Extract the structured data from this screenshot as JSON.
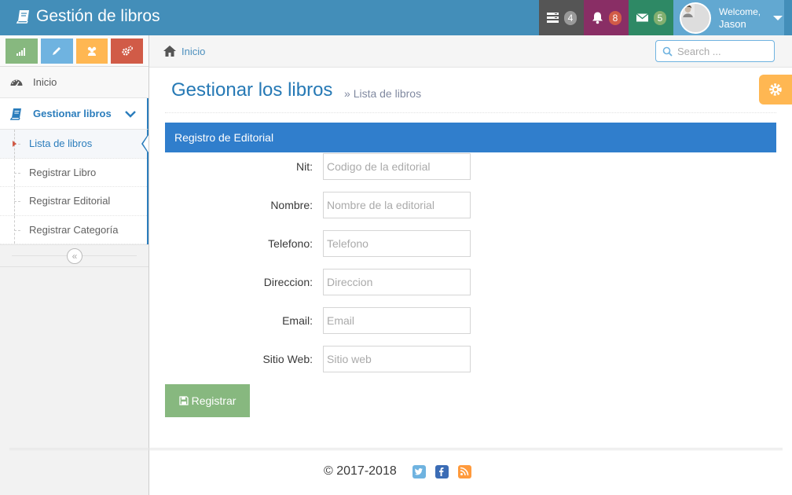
{
  "navbar": {
    "brand": "Gestión de libros",
    "tasks_count": "4",
    "notifications_count": "8",
    "messages_count": "5",
    "welcome": "Welcome,",
    "user_name": "Jason"
  },
  "sidebar": {
    "items": [
      {
        "label": "Inicio"
      },
      {
        "label": "Gestionar libros"
      }
    ],
    "submenu": [
      {
        "label": "Lista de libros"
      },
      {
        "label": "Registrar Libro"
      },
      {
        "label": "Registrar Editorial"
      },
      {
        "label": "Registrar Categoría"
      }
    ]
  },
  "breadcrumb": {
    "home": "Inicio"
  },
  "search": {
    "placeholder": "Search ..."
  },
  "page": {
    "title": "Gestionar los libros",
    "subtitle": "Lista de libros"
  },
  "form": {
    "header": "Registro de Editorial",
    "fields": [
      {
        "label": "Nit:",
        "placeholder": "Codigo de la editorial"
      },
      {
        "label": "Nombre:",
        "placeholder": "Nombre de la editorial"
      },
      {
        "label": "Telefono:",
        "placeholder": "Telefono"
      },
      {
        "label": "Direccion:",
        "placeholder": "Direccion"
      },
      {
        "label": "Email:",
        "placeholder": "Email"
      },
      {
        "label": "Sitio Web:",
        "placeholder": "Sitio web"
      }
    ],
    "submit": "Registrar"
  },
  "footer": {
    "copyright": "© 2017-2018"
  }
}
